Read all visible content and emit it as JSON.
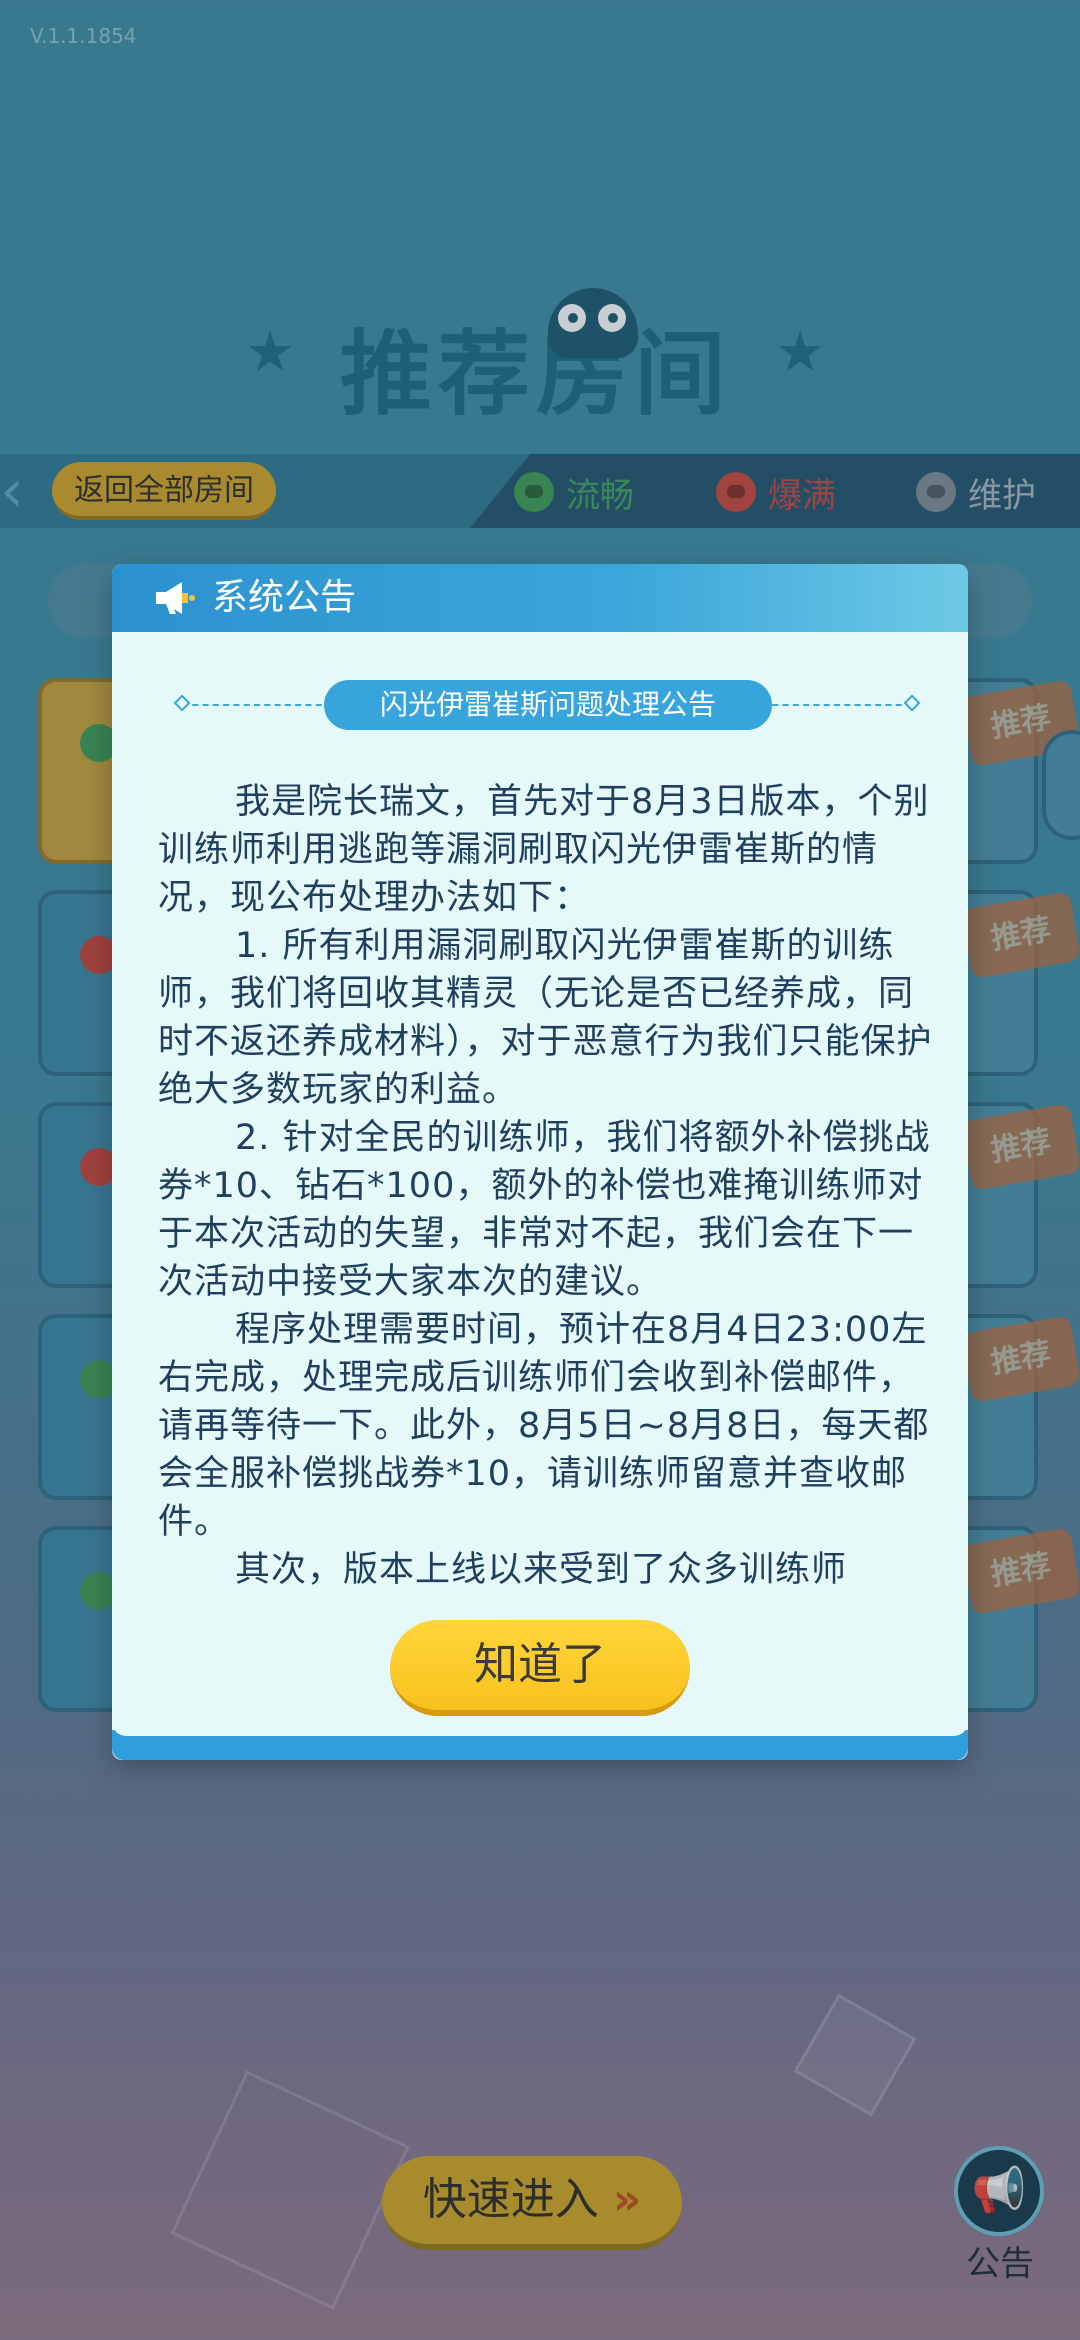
{
  "app": {
    "version": "V.1.1.1854",
    "page_title": "推荐房间"
  },
  "toolbar": {
    "back_label": "返回全部房间",
    "legend": {
      "smooth": "流畅",
      "full": "爆满",
      "maintenance": "维护"
    }
  },
  "room_badge": "推荐",
  "footer": {
    "quick_enter_label": "快速进入",
    "notice_label": "公告"
  },
  "dialog": {
    "title": "系统公告",
    "subtitle": "闪光伊雷崔斯问题处理公告",
    "paragraphs": [
      "我是院长瑞文，首先对于8月3日版本，个别训练师利用逃跑等漏洞刷取闪光伊雷崔斯的情况，现公布处理办法如下：",
      "1. 所有利用漏洞刷取闪光伊雷崔斯的训练师，我们将回收其精灵（无论是否已经养成，同时不返还养成材料），对于恶意行为我们只能保护绝大多数玩家的利益。",
      "2. 针对全民的训练师，我们将额外补偿挑战券*10、钻石*100，额外的补偿也难掩训练师对于本次活动的失望，非常对不起，我们会在下一次活动中接受大家本次的建议。",
      "程序处理需要时间，预计在8月4日23:00左右完成，处理完成后训练师们会收到补偿邮件，请再等待一下。此外，8月5日~8月8日，每天都会全服补偿挑战券*10，请训练师留意并查收邮件。",
      "其次，版本上线以来受到了众多训练师"
    ],
    "confirm_label": "知道了"
  },
  "colors": {
    "dialog_bg": "#e5f9f9",
    "header_blue": "#2c92cf",
    "confirm_yellow": "#f8c21d",
    "text_dark_blue": "#1e3f5e"
  }
}
